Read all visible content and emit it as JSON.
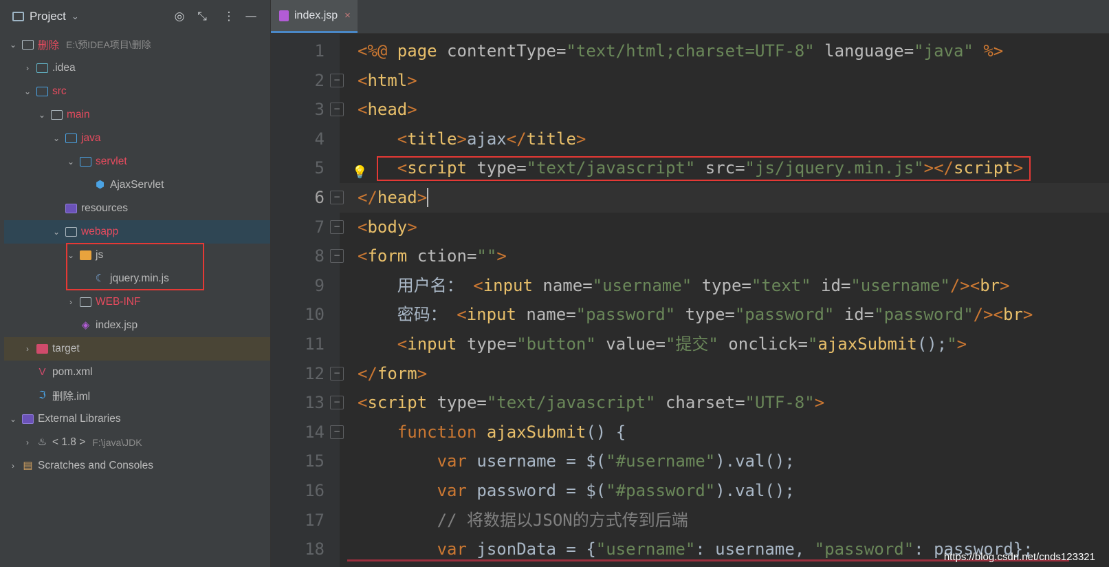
{
  "project_panel": {
    "title": "Project",
    "icons": [
      "target-icon",
      "collapse-icon",
      "more-icon",
      "minimize-icon"
    ],
    "tree": [
      {
        "depth": 0,
        "expanded": true,
        "icon": "folder-icon",
        "label": "删除",
        "label_color": "red",
        "path": "E:\\预IDEA项目\\删除"
      },
      {
        "depth": 1,
        "expanded": false,
        "icon": "idea-folder-icon",
        "label": ".idea"
      },
      {
        "depth": 1,
        "expanded": true,
        "icon": "source-folder-icon",
        "label": "src",
        "label_color": "red"
      },
      {
        "depth": 2,
        "expanded": true,
        "icon": "folder-icon",
        "label": "main",
        "label_color": "red"
      },
      {
        "depth": 3,
        "expanded": true,
        "icon": "java-folder-icon",
        "label": "java",
        "label_color": "red"
      },
      {
        "depth": 4,
        "expanded": true,
        "icon": "package-icon",
        "label": "servlet",
        "label_color": "red"
      },
      {
        "depth": 5,
        "icon": "class-icon",
        "label": "AjaxServlet"
      },
      {
        "depth": 3,
        "icon": "resources-folder-icon",
        "label": "resources"
      },
      {
        "depth": 3,
        "expanded": true,
        "icon": "web-folder-icon",
        "label": "webapp",
        "label_color": "red",
        "selected": true
      },
      {
        "depth": 4,
        "expanded": true,
        "icon": "js-folder-icon",
        "label": "js"
      },
      {
        "depth": 5,
        "icon": "jquery-file-icon",
        "label": "jquery.min.js"
      },
      {
        "depth": 4,
        "expanded": false,
        "icon": "folder-icon",
        "label": "WEB-INF",
        "label_color": "red"
      },
      {
        "depth": 4,
        "icon": "jsp-file-icon",
        "label": "index.jsp"
      },
      {
        "depth": 1,
        "expanded": false,
        "icon": "excluded-folder-icon",
        "label": "target",
        "highlight": true
      },
      {
        "depth": 1,
        "icon": "maven-file-icon",
        "label": "pom.xml"
      },
      {
        "depth": 1,
        "icon": "iml-file-icon",
        "label": "删除.iml"
      },
      {
        "depth": 0,
        "expanded": true,
        "icon": "library-icon",
        "label": "External Libraries"
      },
      {
        "depth": 1,
        "expanded": false,
        "icon": "jdk-icon",
        "label": "< 1.8 >",
        "path": "F:\\java\\JDK"
      },
      {
        "depth": 0,
        "expanded": false,
        "icon": "scratches-icon",
        "label": "Scratches and Consoles"
      }
    ]
  },
  "editor": {
    "tab": {
      "label": "index.jsp",
      "close": "×"
    },
    "current_line": 6,
    "lines": [
      {
        "n": "1",
        "parts": [
          [
            "k",
            "<%@ "
          ],
          [
            "t",
            "page "
          ],
          [
            "a",
            "contentType="
          ],
          [
            "s",
            "\"text/html;charset=UTF-8\""
          ],
          [
            "a",
            " language="
          ],
          [
            "s",
            "\"java\""
          ],
          [
            "k",
            " %>"
          ]
        ]
      },
      {
        "n": "2",
        "parts": [
          [
            "k",
            "<"
          ],
          [
            "t",
            "html"
          ],
          [
            "k",
            ">"
          ]
        ]
      },
      {
        "n": "3",
        "parts": [
          [
            "k",
            "<"
          ],
          [
            "t",
            "head"
          ],
          [
            "k",
            ">"
          ]
        ]
      },
      {
        "n": "4",
        "parts": [
          [
            "p",
            "    "
          ],
          [
            "k",
            "<"
          ],
          [
            "t",
            "title"
          ],
          [
            "k",
            ">"
          ],
          [
            "p",
            "ajax"
          ],
          [
            "k",
            "</"
          ],
          [
            "t",
            "title"
          ],
          [
            "k",
            ">"
          ]
        ]
      },
      {
        "n": "5",
        "parts": [
          [
            "p",
            "    "
          ],
          [
            "k",
            "<"
          ],
          [
            "t",
            "script "
          ],
          [
            "a",
            "type="
          ],
          [
            "s",
            "\"text/javascript\""
          ],
          [
            "a",
            " src="
          ],
          [
            "s",
            "\"js/jquery.min.js\""
          ],
          [
            "k",
            "></"
          ],
          [
            "t",
            "script"
          ],
          [
            "k",
            ">"
          ]
        ]
      },
      {
        "n": "6",
        "parts": [
          [
            "k",
            "</"
          ],
          [
            "t",
            "head"
          ],
          [
            "k",
            ">"
          ]
        ]
      },
      {
        "n": "7",
        "parts": [
          [
            "k",
            "<"
          ],
          [
            "t",
            "body"
          ],
          [
            "k",
            ">"
          ]
        ]
      },
      {
        "n": "8",
        "parts": [
          [
            "k",
            "<"
          ],
          [
            "t",
            "form "
          ],
          [
            "a",
            "ction="
          ],
          [
            "s",
            "\"\""
          ],
          [
            "k",
            ">"
          ]
        ]
      },
      {
        "n": "9",
        "parts": [
          [
            "p",
            "    用户名： "
          ],
          [
            "k",
            "<"
          ],
          [
            "t",
            "input "
          ],
          [
            "a",
            "name="
          ],
          [
            "s",
            "\"username\""
          ],
          [
            "a",
            " type="
          ],
          [
            "s",
            "\"text\""
          ],
          [
            "a",
            " id="
          ],
          [
            "s",
            "\"username\""
          ],
          [
            "k",
            "/><"
          ],
          [
            "t",
            "br"
          ],
          [
            "k",
            ">"
          ]
        ]
      },
      {
        "n": "10",
        "parts": [
          [
            "p",
            "    密码： "
          ],
          [
            "k",
            "<"
          ],
          [
            "t",
            "input "
          ],
          [
            "a",
            "name="
          ],
          [
            "s",
            "\"password\""
          ],
          [
            "a",
            " type="
          ],
          [
            "s",
            "\"password\""
          ],
          [
            "a",
            " id="
          ],
          [
            "s",
            "\"password\""
          ],
          [
            "k",
            "/><"
          ],
          [
            "t",
            "br"
          ],
          [
            "k",
            ">"
          ]
        ]
      },
      {
        "n": "11",
        "parts": [
          [
            "p",
            "    "
          ],
          [
            "k",
            "<"
          ],
          [
            "t",
            "input "
          ],
          [
            "a",
            "type="
          ],
          [
            "s",
            "\"button\""
          ],
          [
            "a",
            " value="
          ],
          [
            "s",
            "\"提交\""
          ],
          [
            "a",
            " onclick="
          ],
          [
            "s",
            "\""
          ],
          [
            "t",
            "ajaxSubmit"
          ],
          [
            "p",
            "();"
          ],
          [
            "s",
            "\""
          ],
          [
            "k",
            ">"
          ]
        ]
      },
      {
        "n": "12",
        "parts": [
          [
            "k",
            "</"
          ],
          [
            "t",
            "form"
          ],
          [
            "k",
            ">"
          ]
        ]
      },
      {
        "n": "13",
        "parts": [
          [
            "k",
            "<"
          ],
          [
            "t",
            "script "
          ],
          [
            "a",
            "type="
          ],
          [
            "s",
            "\"text/javascript\""
          ],
          [
            "a",
            " charset="
          ],
          [
            "s",
            "\"UTF-8\""
          ],
          [
            "k",
            ">"
          ]
        ]
      },
      {
        "n": "14",
        "parts": [
          [
            "p",
            "    "
          ],
          [
            "k",
            "function "
          ],
          [
            "t",
            "ajaxSubmit"
          ],
          [
            "p",
            "() {"
          ]
        ]
      },
      {
        "n": "15",
        "parts": [
          [
            "p",
            "        "
          ],
          [
            "k",
            "var "
          ],
          [
            "p",
            "username = $("
          ],
          [
            "s",
            "\"#username\""
          ],
          [
            "p",
            ").val();"
          ]
        ]
      },
      {
        "n": "16",
        "parts": [
          [
            "p",
            "        "
          ],
          [
            "k",
            "var "
          ],
          [
            "p",
            "password = $("
          ],
          [
            "s",
            "\"#password\""
          ],
          [
            "p",
            ").val();"
          ]
        ]
      },
      {
        "n": "17",
        "parts": [
          [
            "p",
            "        "
          ],
          [
            "cm",
            "// 将数据以JSON的方式传到后端"
          ]
        ]
      },
      {
        "n": "18",
        "parts": [
          [
            "p",
            "        "
          ],
          [
            "k",
            "var "
          ],
          [
            "p",
            "jsonData = {"
          ],
          [
            "s",
            "\"username\""
          ],
          [
            "p",
            ": username, "
          ],
          [
            "s",
            "\"password\""
          ],
          [
            "p",
            ": password};"
          ]
        ]
      }
    ]
  },
  "watermark": "https://blog.csdn.net/cnds123321"
}
